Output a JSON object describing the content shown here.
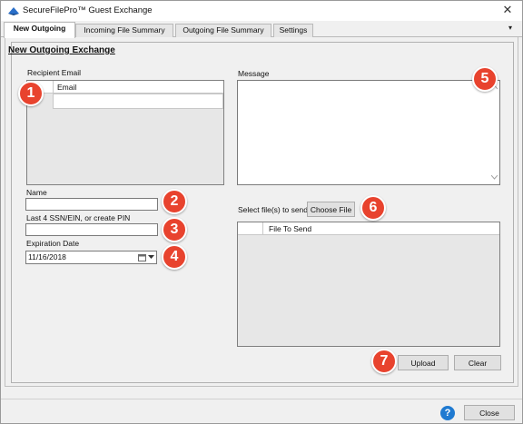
{
  "window": {
    "title": "SecureFilePro™ Guest Exchange",
    "close_glyph": "✕"
  },
  "tabs": [
    {
      "label": "New Outgoing",
      "active": true
    },
    {
      "label": "Incoming File Summary",
      "active": false
    },
    {
      "label": "Outgoing File Summary",
      "active": false
    },
    {
      "label": "Settings",
      "active": false
    }
  ],
  "tab_menu_glyph": "▾",
  "form": {
    "heading": "New Outgoing Exchange",
    "recipient_email_label": "Recipient Email",
    "email_column_header": "Email",
    "name_label": "Name",
    "name_value": "",
    "ssn_label": "Last 4 SSN/EIN, or create PIN",
    "ssn_value": "",
    "expiration_label": "Expiration Date",
    "expiration_value": "11/16/2018",
    "message_label": "Message",
    "message_value": "",
    "select_files_label": "Select file(s) to send",
    "choose_file_button": "Choose File",
    "file_column_header": "File To Send",
    "upload_button": "Upload",
    "clear_button": "Clear"
  },
  "callouts": [
    "1",
    "2",
    "3",
    "4",
    "5",
    "6",
    "7"
  ],
  "callout_color": "#e8432e",
  "footer": {
    "help_glyph": "?",
    "close_button": "Close"
  },
  "icons": [
    "app-logo-icon",
    "close-icon",
    "tab-menu-chevron-icon",
    "calendar-icon",
    "dropdown-arrow-icon",
    "help-icon",
    "scroll-up-icon",
    "scroll-down-icon"
  ]
}
